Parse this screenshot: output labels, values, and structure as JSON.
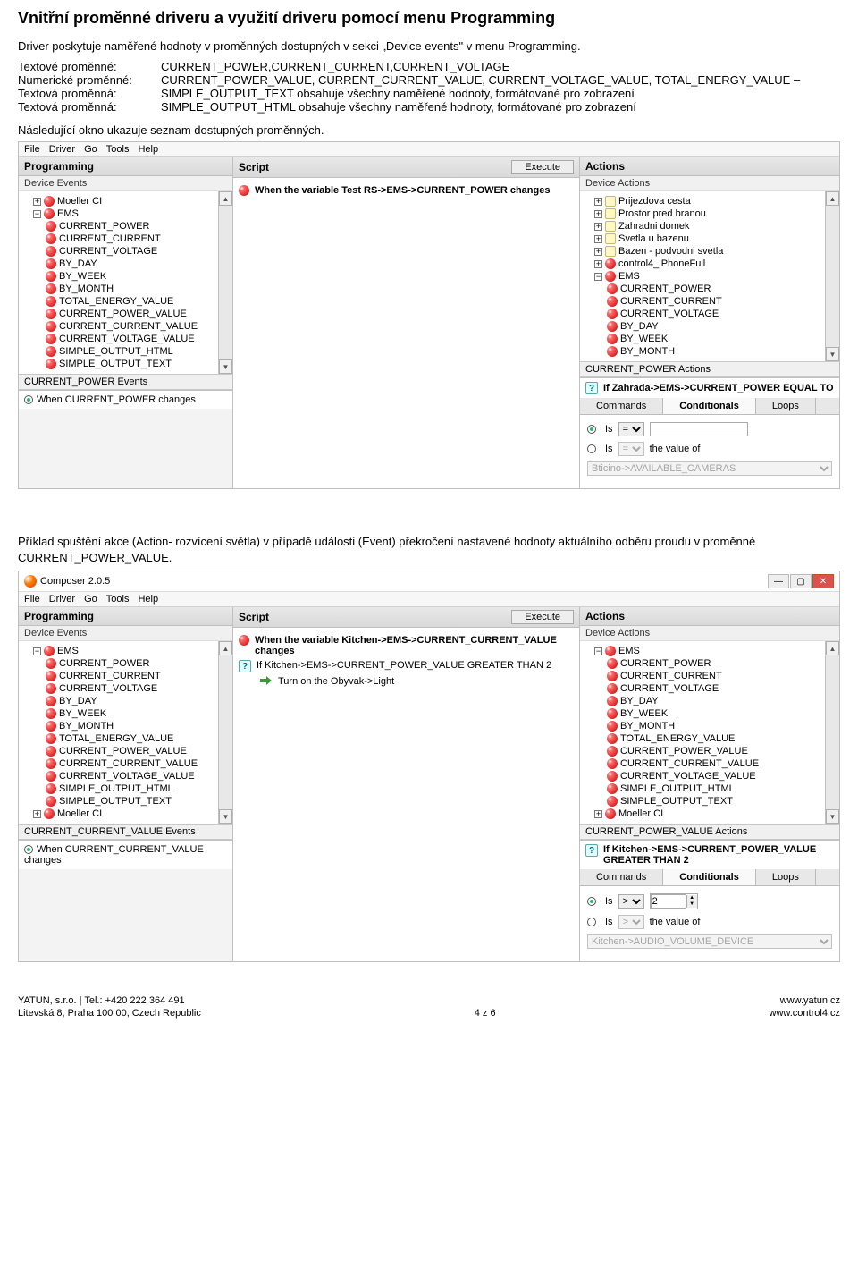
{
  "doc_title": "Vnitřní proměnné driveru a využití driveru pomocí menu Programming",
  "intro": "Driver poskytuje naměřené hodnoty v proměnných dostupných v sekci „Device events\" v menu Programming.",
  "vars": [
    {
      "lbl": "Textové proměnné:",
      "val": "CURRENT_POWER,CURRENT_CURRENT,CURRENT_VOLTAGE"
    },
    {
      "lbl": "Numerické proměnné:",
      "val": "CURRENT_POWER_VALUE, CURRENT_CURRENT_VALUE, CURRENT_VOLTAGE_VALUE, TOTAL_ENERGY_VALUE –"
    },
    {
      "lbl": "Textová proměnná:",
      "val": "SIMPLE_OUTPUT_TEXT  obsahuje všechny naměřené  hodnoty,  formátované pro zobrazení"
    },
    {
      "lbl": "Textová proměnná:",
      "val": "SIMPLE_OUTPUT_HTML  obsahuje všechny naměřené  hodnoty,  formátované pro zobrazení"
    }
  ],
  "note1": "Následující okno ukazuje seznam dostupných proměnných.",
  "bignote": "Příklad spuštění akce (Action- rozvícení světla) v případě události (Event) překročení nastavené hodnoty aktuálního odběru proudu v proměnné CURRENT_POWER_VALUE.",
  "menubar": [
    "File",
    "Driver",
    "Go",
    "Tools",
    "Help"
  ],
  "shot1": {
    "paneProg": {
      "title": "Programming",
      "sub": "Device Events"
    },
    "tree1_root": [
      {
        "t": "Moeller CI",
        "plus": true
      },
      {
        "t": "EMS",
        "minus": true,
        "children": [
          "CURRENT_POWER",
          "CURRENT_CURRENT",
          "CURRENT_VOLTAGE",
          "BY_DAY",
          "BY_WEEK",
          "BY_MONTH",
          "TOTAL_ENERGY_VALUE",
          "CURRENT_POWER_VALUE",
          "CURRENT_CURRENT_VALUE",
          "CURRENT_VOLTAGE_VALUE",
          "SIMPLE_OUTPUT_HTML",
          "SIMPLE_OUTPUT_TEXT"
        ]
      }
    ],
    "eventsHd": "CURRENT_POWER Events",
    "eventsRadio": "When CURRENT_POWER changes",
    "paneScript": {
      "title": "Script",
      "exec": "Execute"
    },
    "scriptLine": "When the variable Test RS->EMS->CURRENT_POWER changes",
    "paneActions": {
      "title": "Actions",
      "sub": "Device Actions"
    },
    "tree2_root": [
      {
        "t": "Prijezdova cesta",
        "plus": true,
        "room": true
      },
      {
        "t": "Prostor pred branou",
        "plus": true,
        "room": true
      },
      {
        "t": "Zahradni domek",
        "plus": true,
        "room": true
      },
      {
        "t": "Svetla u bazenu",
        "plus": true,
        "room": true
      },
      {
        "t": "Bazen - podvodni svetla",
        "plus": true,
        "room": true
      },
      {
        "t": "control4_iPhoneFull",
        "plus": true
      },
      {
        "t": "EMS",
        "minus": true,
        "children": [
          "CURRENT_POWER",
          "CURRENT_CURRENT",
          "CURRENT_VOLTAGE",
          "BY_DAY",
          "BY_WEEK",
          "BY_MONTH"
        ]
      }
    ],
    "actionsHd": "CURRENT_POWER Actions",
    "condLine": "If  Zahrada->EMS->CURRENT_POWER  EQUAL  TO",
    "tabs": [
      "Commands",
      "Conditionals",
      "Loops"
    ],
    "cond_is": "Is",
    "cond_op": "=",
    "cond_valueof": "the value of",
    "cond_sel": "Bticino->AVAILABLE_CAMERAS"
  },
  "shot2": {
    "title": "Composer 2.0.5",
    "paneProg": {
      "title": "Programming",
      "sub": "Device Events"
    },
    "tree1_root": [
      {
        "t": "EMS",
        "minus": true,
        "children": [
          "CURRENT_POWER",
          "CURRENT_CURRENT",
          "CURRENT_VOLTAGE",
          "BY_DAY",
          "BY_WEEK",
          "BY_MONTH",
          "TOTAL_ENERGY_VALUE",
          "CURRENT_POWER_VALUE",
          "CURRENT_CURRENT_VALUE",
          "CURRENT_VOLTAGE_VALUE",
          "SIMPLE_OUTPUT_HTML",
          "SIMPLE_OUTPUT_TEXT"
        ]
      },
      {
        "t": "Moeller CI",
        "plus": true
      }
    ],
    "eventsHd": "CURRENT_CURRENT_VALUE Events",
    "eventsRadio": "When CURRENT_CURRENT_VALUE changes",
    "paneScript": {
      "title": "Script",
      "exec": "Execute"
    },
    "scriptLines": [
      {
        "bold": true,
        "icon": "red",
        "txt": "When the variable Kitchen->EMS->CURRENT_CURRENT_VALUE changes"
      },
      {
        "bold": false,
        "icon": "q",
        "txt": "If Kitchen->EMS->CURRENT_POWER_VALUE GREATER THAN 2"
      },
      {
        "bold": false,
        "icon": "arr",
        "txt": "Turn on the Obyvak->Light",
        "indent": true
      }
    ],
    "paneActions": {
      "title": "Actions",
      "sub": "Device Actions"
    },
    "tree2_root": [
      {
        "t": "EMS",
        "minus": true,
        "children": [
          "CURRENT_POWER",
          "CURRENT_CURRENT",
          "CURRENT_VOLTAGE",
          "BY_DAY",
          "BY_WEEK",
          "BY_MONTH",
          "TOTAL_ENERGY_VALUE",
          "CURRENT_POWER_VALUE",
          "CURRENT_CURRENT_VALUE",
          "CURRENT_VOLTAGE_VALUE",
          "SIMPLE_OUTPUT_HTML",
          "SIMPLE_OUTPUT_TEXT"
        ]
      },
      {
        "t": "Moeller CI",
        "plus": true
      }
    ],
    "actionsHd": "CURRENT_POWER_VALUE Actions",
    "condLine": "If Kitchen->EMS->CURRENT_POWER_VALUE GREATER THAN 2",
    "tabs": [
      "Commands",
      "Conditionals",
      "Loops"
    ],
    "cond_is": "Is",
    "cond_op": ">",
    "cond_val": "2",
    "cond_valueof": "the value of",
    "cond_sel": "Kitchen->AUDIO_VOLUME_DEVICE"
  },
  "footer": {
    "l1": "YATUN, s.r.o. | Tel.: +420 222 364 491",
    "l2": "Litevská 8, Praha 100 00, Czech Republic",
    "mid": "4 z 6",
    "r1": "www.yatun.cz",
    "r2": "www.control4.cz"
  }
}
